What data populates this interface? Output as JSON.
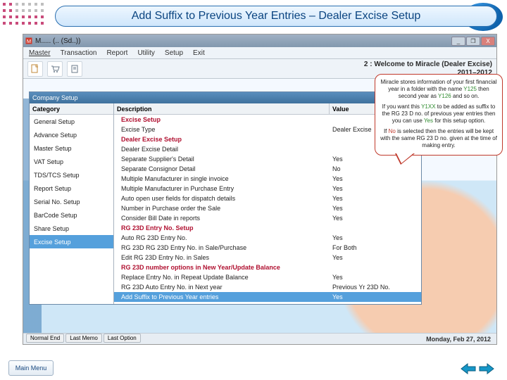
{
  "page_title": "Add Suffix to Previous Year Entries – Dealer Excise Setup",
  "window": {
    "title": "M..... (.. (Sd..))",
    "min": "_",
    "max": "❐",
    "close": "X"
  },
  "menubar": [
    "Master",
    "Transaction",
    "Report",
    "Utility",
    "Setup",
    "Exit"
  ],
  "toolbar_welcome": "2 : Welcome to Miracle (Dealer Excise)\n2011–2012",
  "modal": {
    "title": "Company Setup",
    "close": "X",
    "sidebar_head": "Category",
    "sidebar": [
      "General Setup",
      "Advance Setup",
      "Master Setup",
      "VAT Setup",
      "TDS/TCS Setup",
      "Report Setup",
      "Serial No. Setup",
      "BarCode Setup",
      "Share Setup",
      "Excise Setup"
    ],
    "active_idx": 9,
    "cols": {
      "desc": "Description",
      "val": "Value"
    },
    "rows": [
      {
        "t": "sec",
        "d": "Excise Setup"
      },
      {
        "t": "r",
        "d": "Excise Type",
        "v": "Dealer Excise"
      },
      {
        "t": "sec",
        "d": "Dealer Excise Setup"
      },
      {
        "t": "r",
        "d": "Dealer Excise Detail",
        "v": ""
      },
      {
        "t": "r",
        "d": "Separate Supplier's Detail",
        "v": "Yes"
      },
      {
        "t": "r",
        "d": "Separate Consignor Detail",
        "v": "No"
      },
      {
        "t": "r",
        "d": "Multiple Manufacturer in single invoice",
        "v": "Yes"
      },
      {
        "t": "r",
        "d": "Multiple Manufacturer in Purchase Entry",
        "v": "Yes"
      },
      {
        "t": "r",
        "d": "Auto open user fields for dispatch details",
        "v": "Yes"
      },
      {
        "t": "r",
        "d": "Number in Purchase order the Sale",
        "v": "Yes"
      },
      {
        "t": "r",
        "d": "Consider Bill Date in reports",
        "v": "Yes"
      },
      {
        "t": "sec",
        "d": "RG 23D Entry No. Setup"
      },
      {
        "t": "r",
        "d": "Auto RG 23D Entry No.",
        "v": "Yes"
      },
      {
        "t": "r",
        "d": "RG 23D RG 23D Entry No. in Sale/Purchase",
        "v": "For Both"
      },
      {
        "t": "r",
        "d": "Edit RG 23D Entry No. in Sales",
        "v": "Yes"
      },
      {
        "t": "sec",
        "d": "RG 23D number options in New Year/Update Balance"
      },
      {
        "t": "r",
        "d": "Replace Entry No. in Repeat Update Balance",
        "v": "Yes"
      },
      {
        "t": "r",
        "d": "RG 23D Auto Entry No. in Next year",
        "v": "Previous Yr 23D No."
      },
      {
        "t": "hl",
        "d": "Add Suffix to Previous Year entries",
        "v": "Yes"
      }
    ]
  },
  "bubble": {
    "p1a": "Miracle stores information of your first financial year in a folder with the name ",
    "p1b": " then second year as ",
    "p1c": " and so on.",
    "y125": "Y125",
    "y126": "Y126",
    "p2a": "If you want this ",
    "yxxx": "Y1XX",
    "p2b": " to be added as suffix to the RG 23 D no. of previous year entries then you can use ",
    "yes": "Yes",
    "p2c": " for this setup option.",
    "p3a": "If ",
    "no": "No",
    "p3b": " is selected then the entries will be kept with the same RG 23 D no. given at the time of making entry."
  },
  "status_date": "Monday, Feb 27, 2012",
  "bottom": [
    "Normal End",
    "Last Memo",
    "Last Option"
  ],
  "mainmenu": "Main Menu"
}
